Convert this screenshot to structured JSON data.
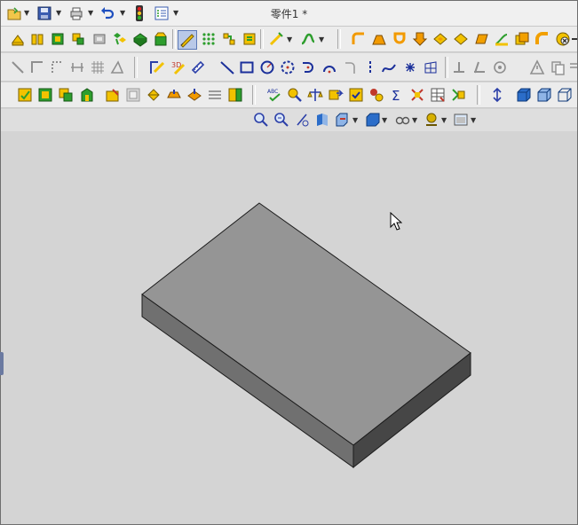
{
  "window": {
    "title": "零件1 *"
  },
  "colors": {
    "toolbar_bg": "#ececec",
    "viewport_bg": "#d4d4d4",
    "part_top": "#959595",
    "part_front": "#6f6f6f",
    "part_side": "#454545",
    "part_outline": "#1c1c1c"
  },
  "icons": {
    "quick_access": [
      "new-open-icon",
      "save-icon",
      "print-icon",
      "undo-icon",
      "traffic-light-icon",
      "options-icon"
    ],
    "features": [
      "extrude-icon",
      "revolve-icon",
      "sweep-icon",
      "loft-icon",
      "shell-icon",
      "pattern-icon",
      "mirror-icon",
      "feature-icon",
      "sketch-icon",
      "grid-icon",
      "relations-icon",
      "measure-icon",
      "smart-dimension-icon",
      "curve-icon",
      "fillet-icon",
      "chamfer-icon",
      "draft-icon",
      "rib-icon",
      "wrap-icon",
      "face-icon",
      "body-icon",
      "surface-icon",
      "delete-face-icon"
    ],
    "sketch": [
      "line-icon",
      "corner-icon",
      "dashed-icon",
      "trim-icon",
      "hatch-icon",
      "angle-icon",
      "sketch-edit-icon",
      "3d-sketch-icon",
      "ruler-icon",
      "line-tool-icon",
      "rectangle-icon",
      "circle-icon",
      "dashed-circle-icon",
      "arc-icon",
      "half-circle-icon",
      "hook-icon",
      "vertical-line-icon",
      "spline-icon",
      "point-icon",
      "mesh-icon",
      "base-icon",
      "tilt-icon",
      "target-icon",
      "warning-icon",
      "copy-icon"
    ],
    "tools": [
      "part-icon",
      "assembly-icon",
      "drawing-icon",
      "shape-icon",
      "feature-paint-icon",
      "material-icon",
      "lamp-icon",
      "sheet-icon",
      "weld-icon",
      "layer-icon",
      "check-icon",
      "spell-check-icon",
      "magnify-icon",
      "balance-icon",
      "move-icon",
      "check-box-icon",
      "simulation-icon",
      "sum-icon",
      "convert-icon",
      "table-icon",
      "tree-icon",
      "origin-axis-icon",
      "view-front-icon",
      "view-iso-icon",
      "view-wire-icon"
    ],
    "view": [
      "zoom-fit-icon",
      "zoom-area-icon",
      "pan-icon",
      "section-icon",
      "display-style-icon",
      "view-orientation-icon",
      "hide-show-icon",
      "appearance-icon",
      "scene-icon"
    ]
  }
}
